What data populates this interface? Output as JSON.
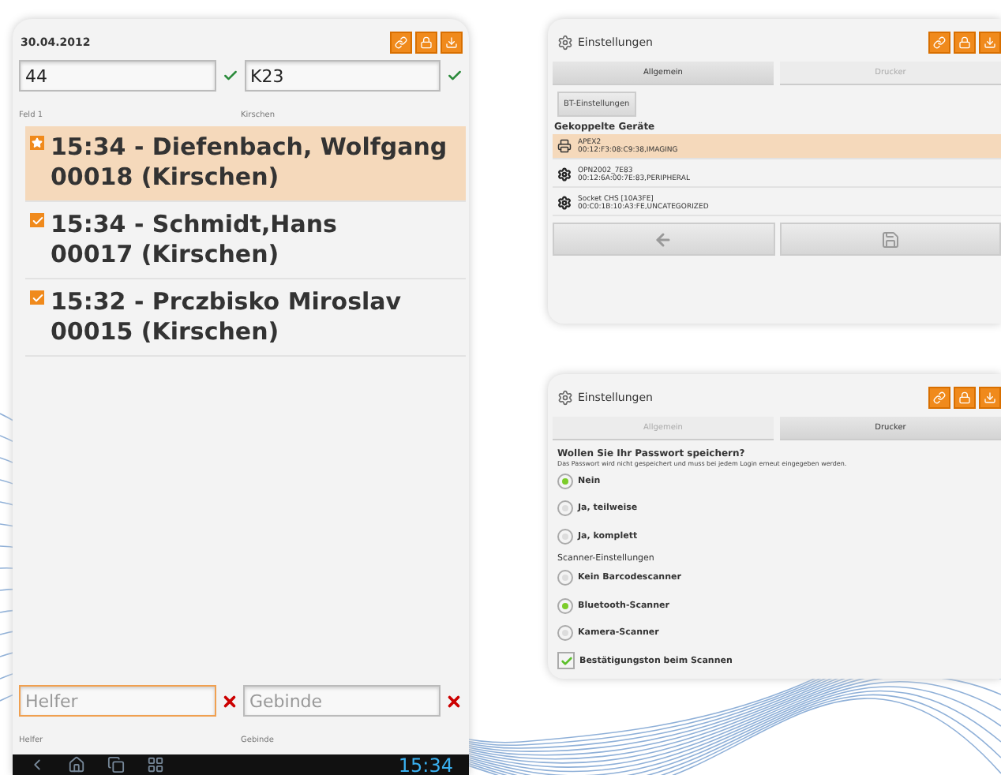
{
  "list_screen": {
    "date": "30.04.2012",
    "fields": [
      {
        "value": "44",
        "label": "Feld 1",
        "valid": true
      },
      {
        "value": "K23",
        "label": "Kirschen",
        "valid": true
      }
    ],
    "entries": [
      {
        "line1": "15:34 - Diefenbach, Wolfgang",
        "line2": "00018 (Kirschen)",
        "kind": "star",
        "selected": true
      },
      {
        "line1": "15:34 - Schmidt,Hans",
        "line2": "00017 (Kirschen)",
        "kind": "check",
        "selected": false
      },
      {
        "line1": "15:32 - Prczbisko Miroslav",
        "line2": "00015 (Kirschen)",
        "kind": "check",
        "selected": false
      }
    ],
    "bottom_fields": [
      {
        "placeholder": "Helfer",
        "label": "Helfer",
        "valid": false,
        "focused": true
      },
      {
        "placeholder": "Gebinde",
        "label": "Gebinde",
        "valid": false,
        "focused": false
      }
    ],
    "nav_bar": {
      "time": "15:34"
    }
  },
  "bt_settings": {
    "title": "Einstellungen",
    "tabs": [
      {
        "label": "Allgemein",
        "selected": true
      },
      {
        "label": "Drucker",
        "selected": false
      }
    ],
    "bt_button": "BT-Einstellungen",
    "section": "Gekoppelte Geräte",
    "devices": [
      {
        "name": "APEX2",
        "address": "00:12:F3:08:C9:38,IMAGING",
        "kind": "printer",
        "selected": true
      },
      {
        "name": "OPN2002_7E83",
        "address": "00:12:6A:00:7E:83,PERIPHERAL",
        "kind": "device",
        "selected": false
      },
      {
        "name": "Socket CHS [10A3FE]",
        "address": "00:C0:1B:10:A3:FE,UNCATEGORIZED",
        "kind": "device",
        "selected": false
      }
    ]
  },
  "password_settings": {
    "title": "Einstellungen",
    "tabs": [
      {
        "label": "Allgemein",
        "selected": false
      },
      {
        "label": "Drucker",
        "selected": true
      }
    ],
    "question": "Wollen Sie Ihr Passwort speichern?",
    "hint": "Das Passwort wird nicht gespeichert und muss bei jedem Login erneut eingegeben werden.",
    "password_options": [
      {
        "label": "Nein",
        "selected": true
      },
      {
        "label": "Ja, teilweise",
        "selected": false
      },
      {
        "label": "Ja, komplett",
        "selected": false
      }
    ],
    "scanner_section": "Scanner-Einstellungen",
    "scanner_options": [
      {
        "label": "Kein Barcodescanner",
        "selected": false
      },
      {
        "label": "Bluetooth-Scanner",
        "selected": true
      },
      {
        "label": "Kamera-Scanner",
        "selected": false
      }
    ],
    "confirm": {
      "label": "Bestätigungston beim Scannen",
      "checked": true
    }
  }
}
